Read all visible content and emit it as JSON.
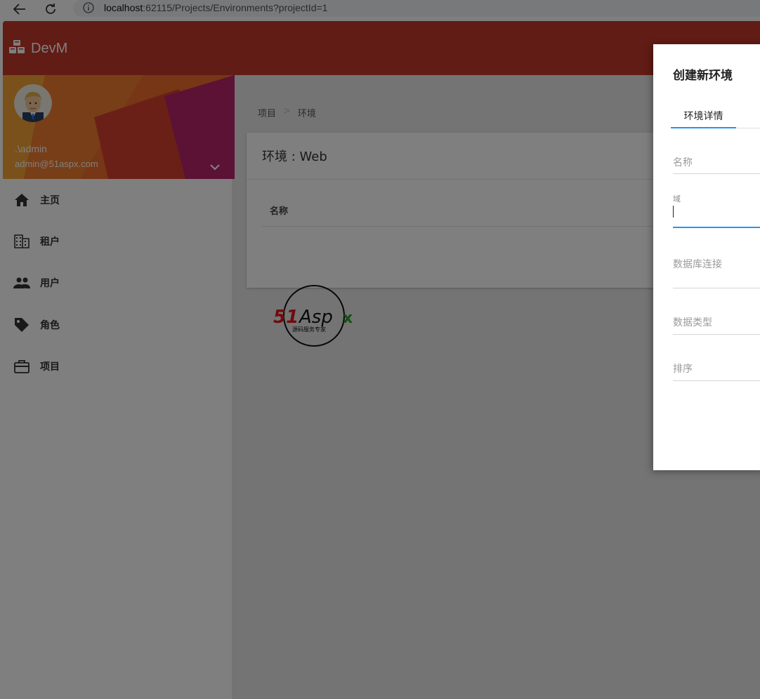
{
  "browser": {
    "url_host": "localhost",
    "url_rest": ":62115/Projects/Environments?projectId=1"
  },
  "app": {
    "brand": "DevM"
  },
  "user": {
    "name": ".\\admin",
    "email": "admin@51aspx.com"
  },
  "menu": [
    {
      "label": "主页",
      "icon": "home-icon"
    },
    {
      "label": "租户",
      "icon": "building-icon"
    },
    {
      "label": "用户",
      "icon": "people-icon"
    },
    {
      "label": "角色",
      "icon": "tag-icon"
    },
    {
      "label": "项目",
      "icon": "briefcase-icon"
    }
  ],
  "breadcrumb": {
    "item1": "项目",
    "sep": ">",
    "item2": "环境"
  },
  "card": {
    "title": "环境 : Web",
    "column_name": "名称"
  },
  "modal": {
    "title": "创建新环境",
    "tab": "环境详情",
    "fields": {
      "name": "名称",
      "domain": "域",
      "db_connection": "数据库连接",
      "db_type": "数据类型",
      "order": "排序"
    }
  },
  "watermark": {
    "text": "51Aspx",
    "subtext": "源码服务专家"
  },
  "colors": {
    "topbar": "#c0392b",
    "accent": "#2196f3"
  }
}
